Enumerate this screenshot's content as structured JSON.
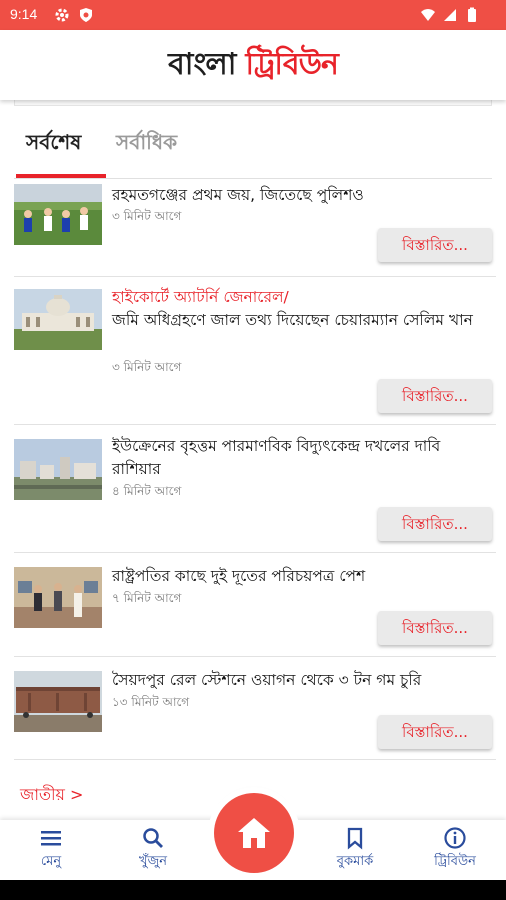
{
  "status_bar": {
    "time": "9:14",
    "icons": [
      "gear-icon",
      "shield-icon",
      "wifi-icon",
      "signal-icon",
      "battery-icon"
    ]
  },
  "app": {
    "logo_part1": "বাংলা",
    "logo_part2": "ট্রিবিউন",
    "accent": "#e8232a",
    "status_color": "#ef4f45",
    "nav_color": "#2a4c9c"
  },
  "tabs": [
    {
      "label": "সর্বশেষ",
      "active": true
    },
    {
      "label": "সর্বাধিক",
      "active": false
    }
  ],
  "articles": [
    {
      "tag": "",
      "title": "রহমতগঞ্জের প্রথম জয়, জিতেছে পুলিশও",
      "time": "৩ মিনিট আগে",
      "button": "বিস্তারিত...",
      "thumb": "football-match"
    },
    {
      "tag": "হাইকোর্টে অ্যাটর্নি জেনারেল/",
      "title": "জমি অধিগ্রহণে জাল তথ্য দিয়েছেন চেয়ারম্যান সেলিম খান",
      "time": "৩ মিনিট আগে",
      "button": "বিস্তারিত...",
      "thumb": "court-building"
    },
    {
      "tag": "",
      "title": "ইউক্রেনের বৃহত্তম পারমাণবিক বিদ্যুৎকেন্দ্র দখলের দাবি রাশিয়ার",
      "time": "৪ মিনিট আগে",
      "button": "বিস্তারিত...",
      "thumb": "power-plant"
    },
    {
      "tag": "",
      "title": "রাষ্ট্রপতির কাছে দুই দূতের পরিচয়পত্র পেশ",
      "time": "৭ মিনিট আগে",
      "button": "বিস্তারিত...",
      "thumb": "ceremony"
    },
    {
      "tag": "",
      "title": "সৈয়দপুর রেল স্টেশনে ওয়াগন থেকে ৩ টন গম চুরি",
      "time": "১৩ মিনিট আগে",
      "button": "বিস্তারিত...",
      "thumb": "train-wagon"
    }
  ],
  "section_link": "জাতীয় >",
  "bottom_nav": [
    {
      "label": "মেনু",
      "icon": "menu-icon"
    },
    {
      "label": "খুঁজুন",
      "icon": "search-icon"
    },
    {
      "label": "",
      "icon": "home-icon"
    },
    {
      "label": "বুকমার্ক",
      "icon": "bookmark-icon"
    },
    {
      "label": "ট্রিবিউন",
      "icon": "info-icon"
    }
  ]
}
